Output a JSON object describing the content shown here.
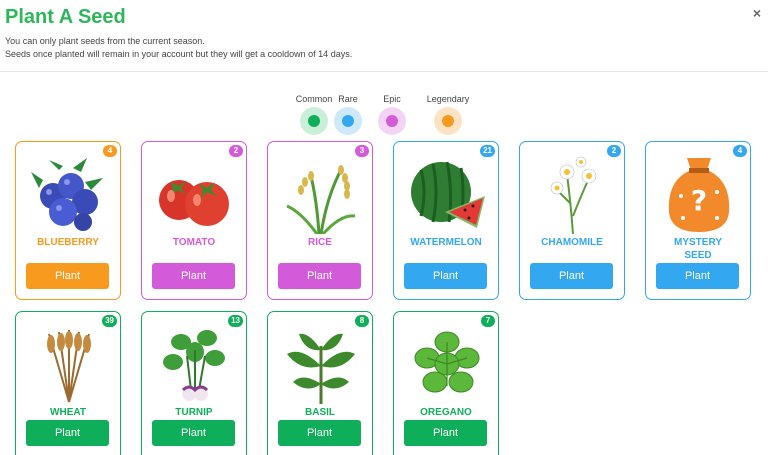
{
  "dialog": {
    "title": "Plant A Seed",
    "subtitle_line1": "You can only plant seeds from the current season.",
    "subtitle_line2": "Seeds once planted will remain in your account but they will get a cooldown of 14 days.",
    "close_icon": "×"
  },
  "rarity_legend": [
    {
      "label": "Common",
      "color": "#0fae5a",
      "bg": "#c9efd9"
    },
    {
      "label": "Rare",
      "color": "#33a8f0",
      "bg": "#cde9fb"
    },
    {
      "label": "Epic",
      "color": "#d35ad9",
      "bg": "#f4d4f5"
    },
    {
      "label": "Legendary",
      "color": "#f79a1e",
      "bg": "#fde3c4"
    }
  ],
  "colors": {
    "legendary": "#f79a1e",
    "epic": "#d35ad9",
    "rare": "#33a8f0",
    "common": "#0fae5a"
  },
  "seeds": [
    {
      "name": "BLUEBERRY",
      "count": "4",
      "rarity": "legendary",
      "button": "Plant",
      "icon": "blueberry-icon"
    },
    {
      "name": "TOMATO",
      "count": "2",
      "rarity": "epic",
      "button": "Plant",
      "icon": "tomato-icon"
    },
    {
      "name": "RICE",
      "count": "3",
      "rarity": "epic",
      "button": "Plant",
      "icon": "rice-icon"
    },
    {
      "name": "WATERMELON",
      "count": "21",
      "rarity": "rare",
      "button": "Plant",
      "icon": "watermelon-icon"
    },
    {
      "name": "CHAMOMILE",
      "count": "2",
      "rarity": "rare",
      "button": "Plant",
      "icon": "chamomile-icon"
    },
    {
      "name": "MYSTERY SEED",
      "count": "4",
      "rarity": "rare",
      "button": "Plant",
      "icon": "mystery-seed-icon"
    },
    {
      "name": "WHEAT",
      "count": "39",
      "rarity": "common",
      "button": "Plant",
      "icon": "wheat-icon"
    },
    {
      "name": "TURNIP",
      "count": "13",
      "rarity": "common",
      "button": "Plant",
      "icon": "turnip-icon"
    },
    {
      "name": "BASIL",
      "count": "8",
      "rarity": "common",
      "button": "Plant",
      "icon": "basil-icon"
    },
    {
      "name": "OREGANO",
      "count": "7",
      "rarity": "common",
      "button": "Plant",
      "icon": "oregano-icon"
    }
  ]
}
